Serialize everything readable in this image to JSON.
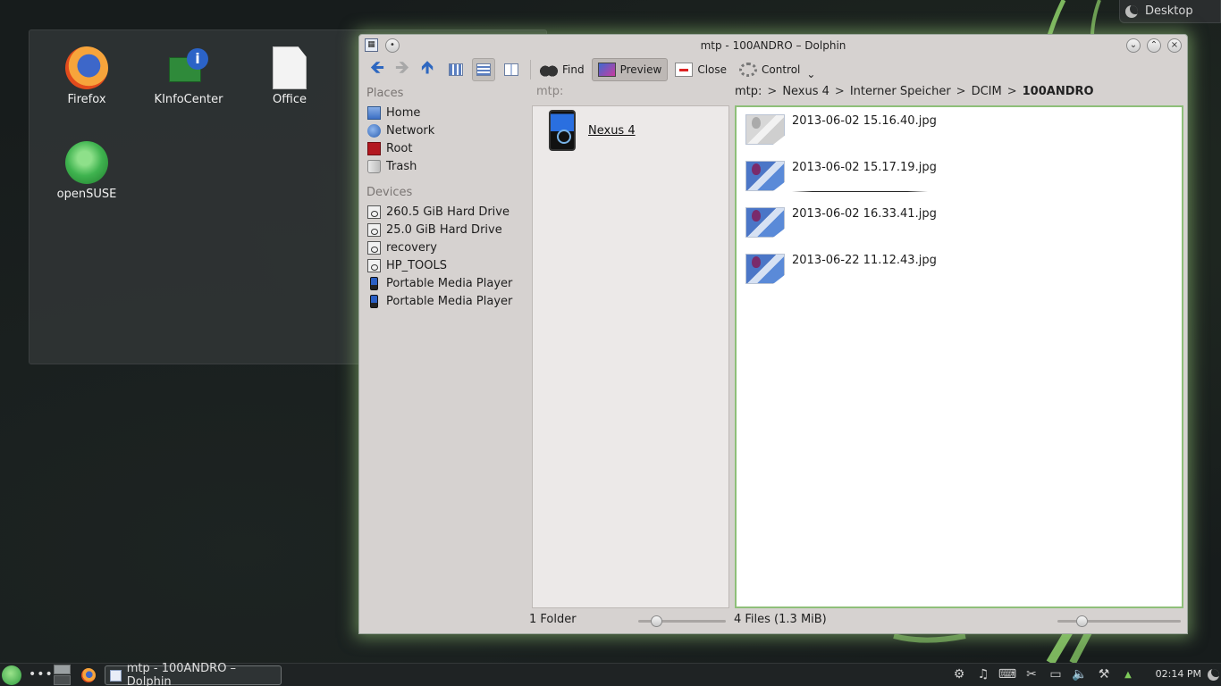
{
  "desktop": {
    "toolbox_label": "Desktop",
    "icons": [
      {
        "label": "Firefox",
        "icon": "firefox-icon"
      },
      {
        "label": "KInfoCenter",
        "icon": "kinfocenter-icon"
      },
      {
        "label": "Office",
        "icon": "office-icon"
      },
      {
        "label": "openSUSE",
        "icon": "opensuse-icon"
      }
    ]
  },
  "window": {
    "title": "mtp - 100ANDRO – Dolphin"
  },
  "toolbar": {
    "find": "Find",
    "preview": "Preview",
    "close": "Close",
    "control": "Control",
    "control_arrow": "⌄"
  },
  "places": {
    "places_header": "Places",
    "devices_header": "Devices",
    "places_items": [
      {
        "label": "Home",
        "icon": "home-icon"
      },
      {
        "label": "Network",
        "icon": "network-icon"
      },
      {
        "label": "Root",
        "icon": "root-folder-icon"
      },
      {
        "label": "Trash",
        "icon": "trash-icon"
      }
    ],
    "device_items": [
      {
        "label": "260.5 GiB Hard Drive",
        "icon": "hard-drive-icon"
      },
      {
        "label": "25.0 GiB Hard Drive",
        "icon": "hard-drive-icon"
      },
      {
        "label": "recovery",
        "icon": "hard-drive-icon"
      },
      {
        "label": "HP_TOOLS",
        "icon": "hard-drive-icon"
      },
      {
        "label": "Portable Media Player",
        "icon": "media-player-icon"
      },
      {
        "label": "Portable Media Player",
        "icon": "media-player-icon"
      }
    ]
  },
  "columns": {
    "col1_header": "mtp:",
    "col1_item": "Nexus 4",
    "breadcrumb": [
      "mtp:",
      "Nexus 4",
      "Interner Speicher",
      "DCIM",
      "100ANDRO"
    ],
    "breadcrumb_sep": ">",
    "files": [
      {
        "name": "2013-06-02 15.16.40.jpg"
      },
      {
        "name": "2013-06-02 15.17.19.jpg"
      },
      {
        "name": "2013-06-02 16.33.41.jpg"
      },
      {
        "name": "2013-06-22 11.12.43.jpg"
      }
    ]
  },
  "status": {
    "left": "1 Folder",
    "right": "4 Files (1.3 MiB)"
  },
  "taskbar": {
    "dots": "•••",
    "task_label": "mtp - 100ANDRO – Dolphin",
    "clock": "02:14 PM",
    "tray_arrow": "▲"
  },
  "colors": {
    "focus_border": "#8ebf79",
    "window_glow": "#96c878"
  }
}
